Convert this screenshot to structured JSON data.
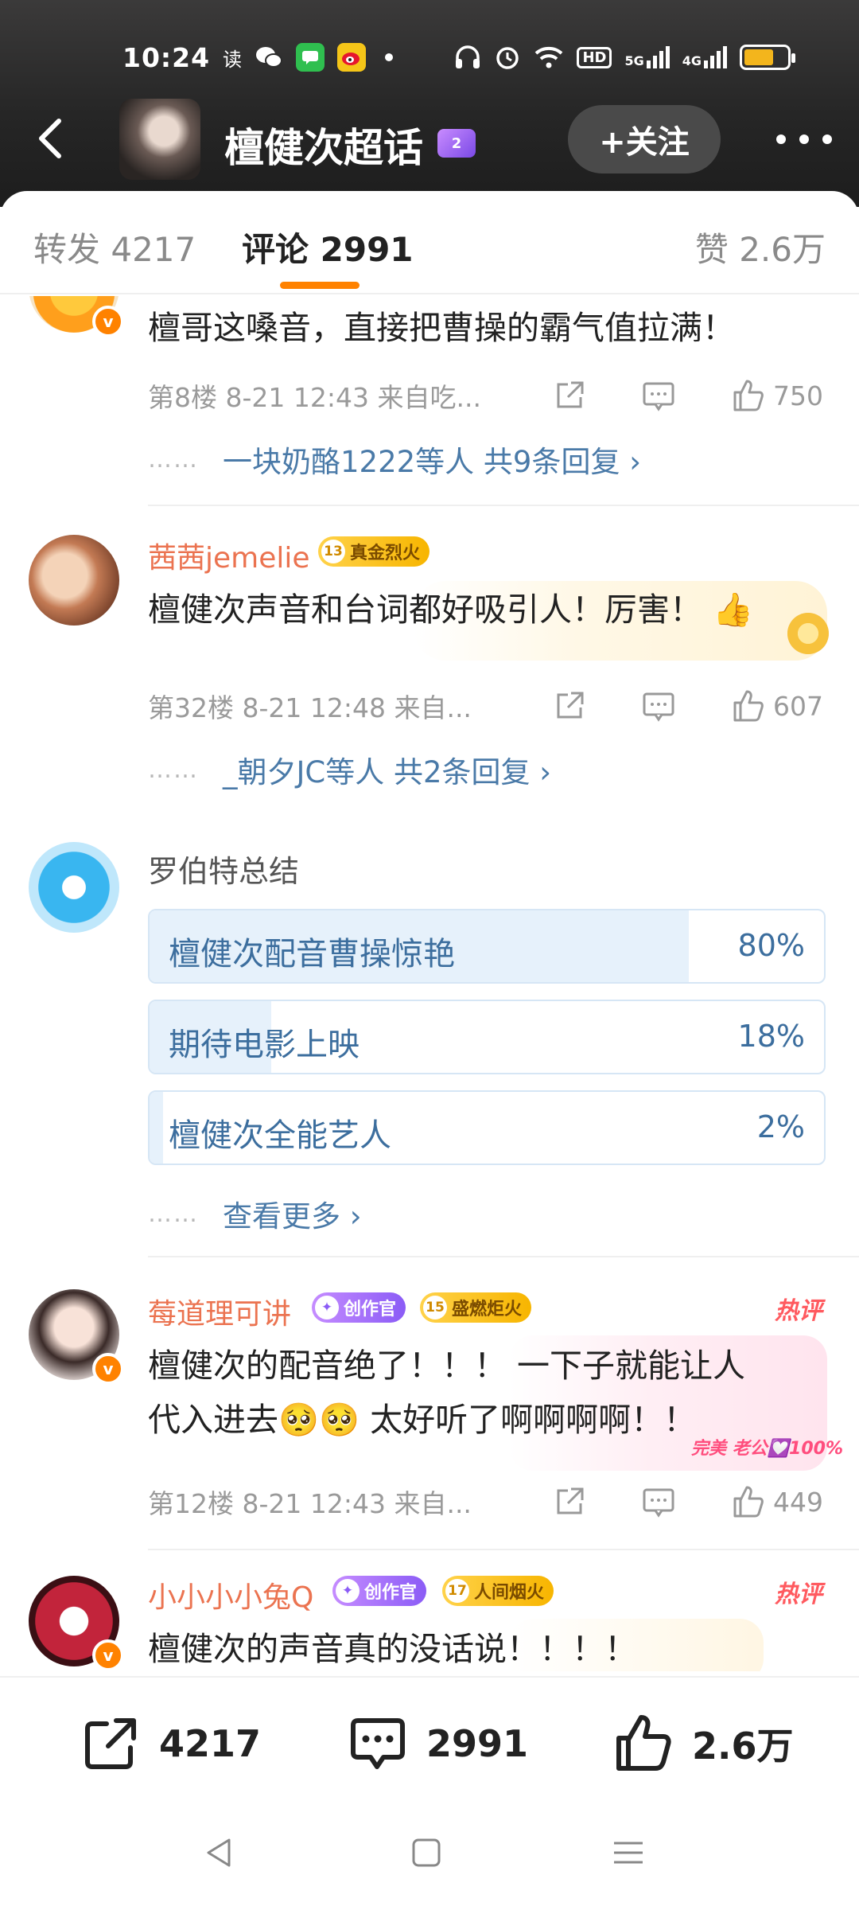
{
  "status_bar": {
    "time": "10:24",
    "read_glyph": "读",
    "network": "HD",
    "signal_5g": "5G",
    "signal_4g": "4G",
    "notification_icons": [
      "read-icon",
      "wechat-icon",
      "message-icon",
      "weibo-icon"
    ],
    "system_icons": [
      "headphones-icon",
      "alarm-icon",
      "wifi-icon",
      "hd-icon",
      "signal-5g-icon",
      "signal-4g-icon",
      "battery-icon"
    ]
  },
  "header": {
    "title": "檀健次超话",
    "level_badge": "2",
    "follow_label": "+关注"
  },
  "tabs": [
    {
      "label": "转发 4217"
    },
    {
      "label": "评论 2991"
    },
    {
      "label": "赞 2.6万"
    }
  ],
  "comments": [
    {
      "text": "檀哥这嗓音，直接把曹操的霸气值拉满！",
      "info": "第8楼  8-21 12:43  来自吃...",
      "likes": "750",
      "replies_text": "一块奶酪1222等人  共9条回复 ›"
    },
    {
      "username": "茜茜jemelie",
      "level": "13",
      "chip": "真金烈火",
      "text": "檀健次声音和台词都好吸引人！厉害！",
      "emoji": "👍",
      "info": "第32楼  8-21 12:48  来自...",
      "likes": "607",
      "replies_text": "_朝夕JC等人  共2条回复 ›"
    }
  ],
  "poll": {
    "author": "罗伯特总结",
    "options": [
      {
        "label": "檀健次配音曹操惊艳",
        "percent": "80%",
        "value": 80
      },
      {
        "label": "期待电影上映",
        "percent": "18%",
        "value": 18
      },
      {
        "label": "檀健次全能艺人",
        "percent": "2%",
        "value": 2
      }
    ],
    "more": "查看更多 ›"
  },
  "hot_comments": [
    {
      "username": "莓道理可讲",
      "creator_chip": "创作官",
      "level": "15",
      "chip": "盛燃炬火",
      "hot_label": "热评",
      "text_line1": "檀健次的配音绝了！！！ 一下子就能让人",
      "text_line2": "代入进去🥺🥺  太好听了啊啊啊啊！！",
      "deco_text": "完美 老公💟100%",
      "info": "第12楼  8-21 12:43  来自...",
      "likes": "449"
    },
    {
      "username": "小小小小兔Q",
      "creator_chip": "创作官",
      "level": "17",
      "chip": "人间烟火",
      "hot_label": "热评",
      "text_line1": "檀健次的声音真的没话说！！！！"
    }
  ],
  "action_bar": {
    "repost_count": "4217",
    "comment_count": "2991",
    "like_count": "2.6万"
  },
  "colors": {
    "accent": "#ff8200",
    "username": "#eb7350",
    "link": "#4a7aa8",
    "poll_fill": "#e6f1fb"
  }
}
